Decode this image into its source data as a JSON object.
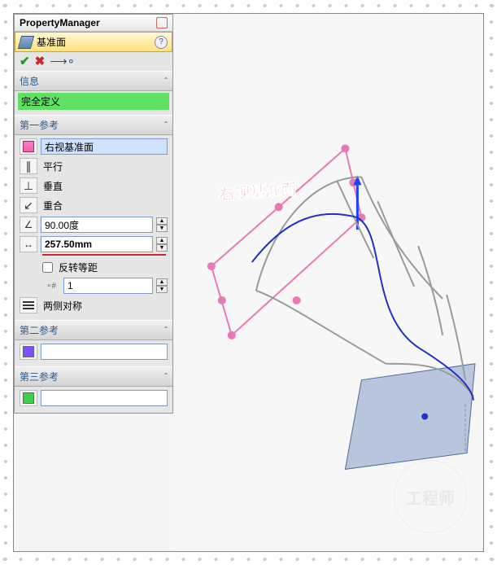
{
  "pm": {
    "title": "PropertyManager",
    "feature_title": "基准面",
    "ok_tip": "OK",
    "cancel_tip": "Cancel",
    "detail_tip": "Detailed Preview"
  },
  "info_section": {
    "head": "信息",
    "status": "完全定义"
  },
  "ref1": {
    "head": "第一参考",
    "selection": "右视基准面",
    "parallel": "平行",
    "perpendicular": "垂直",
    "coincident": "重合",
    "angle": "90.00度",
    "distance": "257.50mm",
    "flip_offset": "反转等距",
    "instances": "1",
    "symmetric": "两侧对称"
  },
  "ref2": {
    "head": "第二参考"
  },
  "ref3": {
    "head": "第三参考"
  },
  "viewport": {
    "plane_label": "右视基准面",
    "watermark": "工程师"
  }
}
